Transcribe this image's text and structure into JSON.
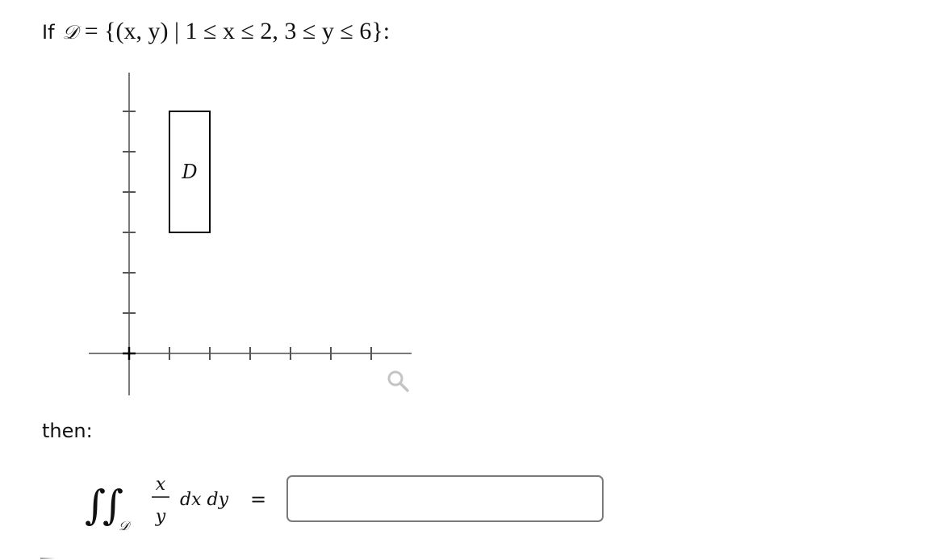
{
  "question": {
    "prefix": "If",
    "region_symbol": "𝒟",
    "set_expression": "= {(x, y) | 1 ≤ x ≤ 2, 3 ≤ y ≤ 6}:",
    "then_label": "then:"
  },
  "graph": {
    "region_label": "D",
    "x_ticks": [
      1,
      2,
      3,
      4,
      5,
      6
    ],
    "y_ticks": [
      1,
      2,
      3,
      4,
      5,
      6
    ],
    "x_range": [
      -1,
      7
    ],
    "y_range": [
      -1,
      7
    ],
    "region": {
      "x_min": 1,
      "x_max": 2,
      "y_min": 3,
      "y_max": 6
    },
    "zoom_icon": "magnifier-icon"
  },
  "integral": {
    "symbol": "∬",
    "subscript": "𝒟",
    "numerator": "x",
    "denominator": "y",
    "differentials": "dx dy",
    "equals": "="
  },
  "answer": {
    "value": "",
    "placeholder": ""
  }
}
